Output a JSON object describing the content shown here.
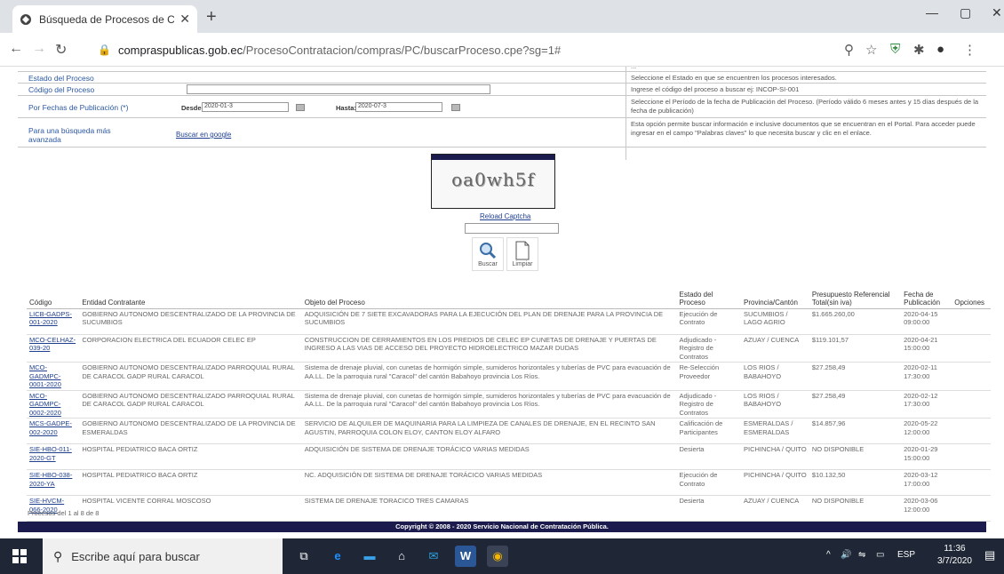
{
  "browser": {
    "tab_title": "Búsqueda de Procesos de Contr",
    "new_tab": "+",
    "url_host": "compraspublicas.gob.ec",
    "url_path": "/ProcesoContratacion/compras/PC/buscarProceso.cpe?sg=1#",
    "controls": {
      "minimize": "—",
      "maximize": "▢",
      "close": "✕"
    }
  },
  "form": {
    "top_cut_text": "...",
    "rows": [
      {
        "label": "Estado del Proceso",
        "help": "Seleccione el Estado en que se encuentren los procesos interesados."
      },
      {
        "label": "Código del Proceso",
        "help": "Ingrese el código del proceso a buscar ej: INCOP-SI-001"
      },
      {
        "label": "Por Fechas de Publicación (*)",
        "help": "Seleccione el Período de la fecha de Publicación del Proceso. (Período válido 6 meses antes y 15 días después de la fecha de publicación)"
      },
      {
        "label": "Para una búsqueda más avanzada",
        "help": "Esta opción permite buscar información e inclusive documentos que se encuentran en el Portal. Para acceder puede ingresar en el campo \"Palabras claves\" lo que necesita buscar y clic en el enlace."
      }
    ],
    "desde_label": "Desde:",
    "desde_value": "2020-01-3",
    "hasta_label": "Hasta:",
    "hasta_value": "2020-07-3",
    "google_link": "Buscar en google"
  },
  "captcha": {
    "text": "oa0wh5f",
    "reload": "Reload Captcha",
    "buscar": "Buscar",
    "limpiar": "Limpiar"
  },
  "table": {
    "headers": [
      "Código",
      "Entidad Contratante",
      "Objeto del Proceso",
      "Estado del Proceso",
      "Provincia/Cantón",
      "Presupuesto Referencial Total(sin iva)",
      "Fecha de Publicación",
      "Opciones"
    ],
    "rows": [
      {
        "code": "LICB-GADPS-001-2020",
        "entity": "GOBIERNO AUTONOMO DESCENTRALIZADO DE LA PROVINCIA DE SUCUMBIOS",
        "object": "ADQUISICIÓN DE 7 SIETE EXCAVADORAS PARA LA EJECUCIÓN DEL PLAN DE DRENAJE PARA LA PROVINCIA DE SUCUMBIOS",
        "status": "Ejecución de Contrato",
        "province": "SUCUMBIOS / LAGO AGRIO",
        "budget": "$1.665.260,00",
        "date": "2020-04-15 09:00:00"
      },
      {
        "code": "MCO-CELHAZ-039-20",
        "entity": "CORPORACION ELECTRICA DEL ECUADOR CELEC EP",
        "object": "CONSTRUCCION DE CERRAMIENTOS EN LOS PREDIOS DE CELEC EP CUNETAS DE DRENAJE Y PUERTAS DE INGRESO A LAS VIAS DE ACCESO DEL PROYECTO HIDROELECTRICO MAZAR DUDAS",
        "status": "Adjudicado - Registro de Contratos",
        "province": "AZUAY / CUENCA",
        "budget": "$119.101,57",
        "date": "2020-04-21 15:00:00"
      },
      {
        "code": "MCO-GADMPC-0001-2020",
        "entity": "GOBIERNO AUTONOMO DESCENTRALIZADO PARROQUIAL RURAL DE CARACOL GADP RURAL CARACOL",
        "object": "Sistema de drenaje pluvial, con cunetas de hormigón simple, sumideros horizontales y tuberías de PVC para evacuación de AA.LL. De la parroquia rural \"Caracol\" del cantón Babahoyo provincia Los Ríos.",
        "status": "Re-Selección Proveedor",
        "province": "LOS RIOS / BABAHOYO",
        "budget": "$27.258,49",
        "date": "2020-02-11 17:30:00"
      },
      {
        "code": "MCO-GADMPC-0002-2020",
        "entity": "GOBIERNO AUTONOMO DESCENTRALIZADO PARROQUIAL RURAL DE CARACOL GADP RURAL CARACOL",
        "object": "Sistema de drenaje pluvial, con cunetas de hormigón simple, sumideros horizontales y tuberías de PVC para evacuación de AA.LL. De la parroquia rural \"Caracol\" del cantón Babahoyo provincia Los Ríos.",
        "status": "Adjudicado - Registro de Contratos",
        "province": "LOS RIOS / BABAHOYO",
        "budget": "$27.258,49",
        "date": "2020-02-12 17:30:00"
      },
      {
        "code": "MCS-GADPE-002-2020",
        "entity": "GOBIERNO AUTONOMO DESCENTRALIZADO DE LA PROVINCIA DE ESMERALDAS",
        "object": "SERVICIO DE ALQUILER DE MAQUINARIA PARA LA LIMPIEZA DE CANALES DE DRENAJE, EN EL RECINTO SAN AGUSTIN, PARROQUIA COLON ELOY, CANTON ELOY ALFARO",
        "status": "Calificación de Participantes",
        "province": "ESMERALDAS / ESMERALDAS",
        "budget": "$14.857,96",
        "date": "2020-05-22 12:00:00"
      },
      {
        "code": "SIE-HBO-011-2020-GT",
        "entity": "HOSPITAL PEDIATRICO BACA ORTIZ",
        "object": "ADQUISICIÓN DE SISTEMA DE DRENAJE TORÁCICO VARIAS MEDIDAS",
        "status": "Desierta",
        "province": "PICHINCHA / QUITO",
        "budget": "NO DISPONIBLE",
        "date": "2020-01-29 15:00:00"
      },
      {
        "code": "SIE-HBO-038-2020-YA",
        "entity": "HOSPITAL PEDIATRICO BACA ORTIZ",
        "object": "NC. ADQUISICIÓN DE SISTEMA DE DRENAJE TORÁCICO VARIAS MEDIDAS",
        "status": "Ejecución de Contrato",
        "province": "PICHINCHA / QUITO",
        "budget": "$10.132,50",
        "date": "2020-03-12 17:00:00"
      },
      {
        "code": "SIE-HVCM-066-2020",
        "entity": "HOSPITAL VICENTE CORRAL MOSCOSO",
        "object": "SISTEMA DE DRENAJE TORACICO TRES CAMARAS",
        "status": "Desierta",
        "province": "AZUAY / CUENCA",
        "budget": "NO DISPONIBLE",
        "date": "2020-03-06 12:00:00"
      }
    ],
    "summary": "Procesos del 1 al 8 de 8"
  },
  "footer": "Copyright © 2008 - 2020 Servicio Nacional de Contratación Pública.",
  "taskbar": {
    "search_placeholder": "Escribe aquí para buscar",
    "lang": "ESP",
    "time": "11:36",
    "date": "3/7/2020"
  }
}
